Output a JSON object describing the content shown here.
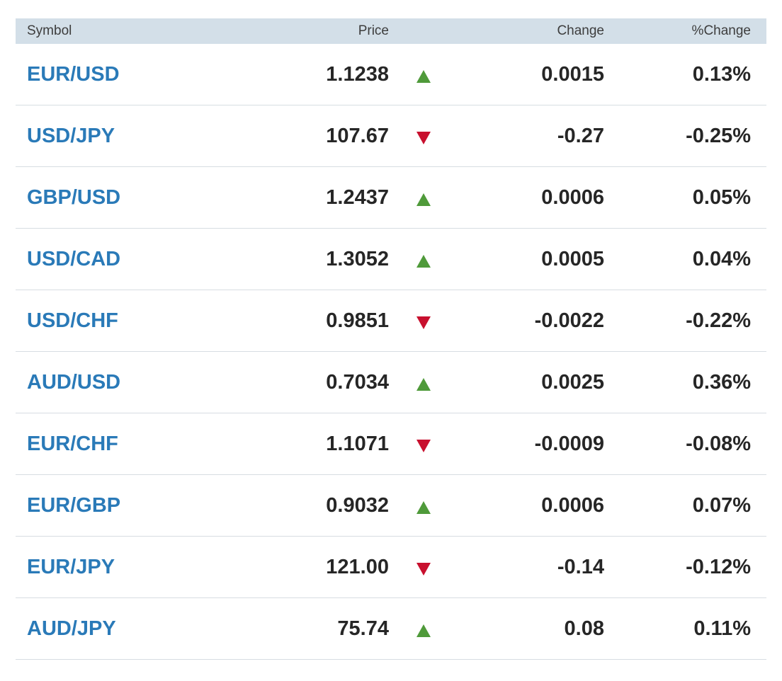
{
  "header": {
    "symbol": "Symbol",
    "price": "Price",
    "change": "Change",
    "pct_change": "%Change"
  },
  "colors": {
    "header_bg": "#d3dfe8",
    "symbol_link": "#2a7ab8",
    "up": "#4f9a3a",
    "down": "#c8102e",
    "value_text": "#262626",
    "row_border": "#d7dde2"
  },
  "rows": [
    {
      "symbol": "EUR/USD",
      "price": "1.1238",
      "direction": "up",
      "direction_icon": "triangle-up-icon",
      "change": "0.0015",
      "pct_change": "0.13%"
    },
    {
      "symbol": "USD/JPY",
      "price": "107.67",
      "direction": "down",
      "direction_icon": "triangle-down-icon",
      "change": "-0.27",
      "pct_change": "-0.25%"
    },
    {
      "symbol": "GBP/USD",
      "price": "1.2437",
      "direction": "up",
      "direction_icon": "triangle-up-icon",
      "change": "0.0006",
      "pct_change": "0.05%"
    },
    {
      "symbol": "USD/CAD",
      "price": "1.3052",
      "direction": "up",
      "direction_icon": "triangle-up-icon",
      "change": "0.0005",
      "pct_change": "0.04%"
    },
    {
      "symbol": "USD/CHF",
      "price": "0.9851",
      "direction": "down",
      "direction_icon": "triangle-down-icon",
      "change": "-0.0022",
      "pct_change": "-0.22%"
    },
    {
      "symbol": "AUD/USD",
      "price": "0.7034",
      "direction": "up",
      "direction_icon": "triangle-up-icon",
      "change": "0.0025",
      "pct_change": "0.36%"
    },
    {
      "symbol": "EUR/CHF",
      "price": "1.1071",
      "direction": "down",
      "direction_icon": "triangle-down-icon",
      "change": "-0.0009",
      "pct_change": "-0.08%"
    },
    {
      "symbol": "EUR/GBP",
      "price": "0.9032",
      "direction": "up",
      "direction_icon": "triangle-up-icon",
      "change": "0.0006",
      "pct_change": "0.07%"
    },
    {
      "symbol": "EUR/JPY",
      "price": "121.00",
      "direction": "down",
      "direction_icon": "triangle-down-icon",
      "change": "-0.14",
      "pct_change": "-0.12%"
    },
    {
      "symbol": "AUD/JPY",
      "price": "75.74",
      "direction": "up",
      "direction_icon": "triangle-up-icon",
      "change": "0.08",
      "pct_change": "0.11%"
    }
  ]
}
